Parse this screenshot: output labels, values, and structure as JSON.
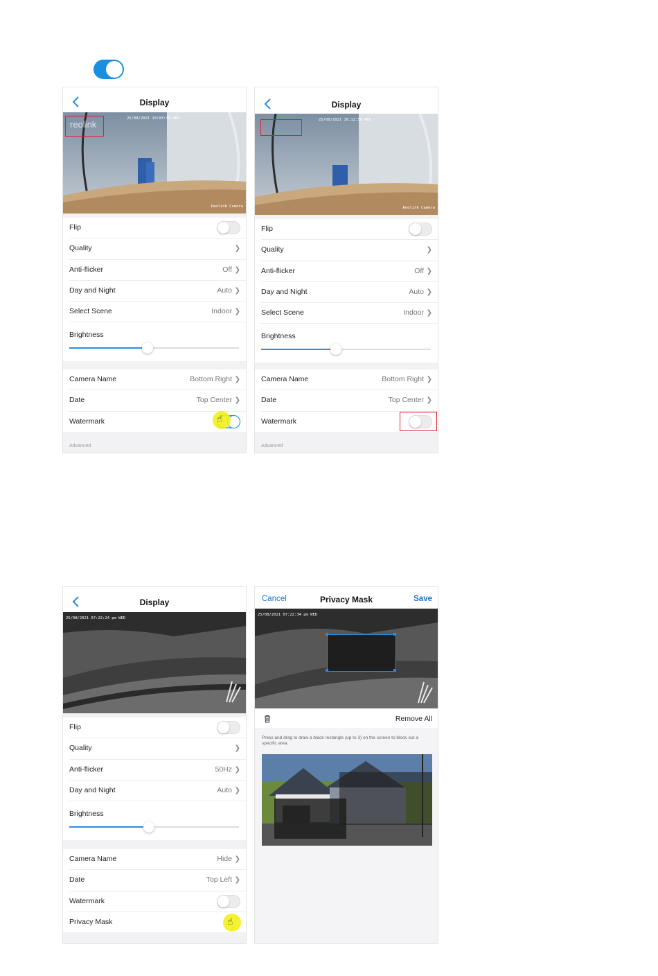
{
  "panel1": {
    "title": "Display",
    "osd_date": "25/08/2021 10:03:35 WED",
    "osd_cam": "Reolink Camera",
    "watermark_logo": "reolink",
    "rows": [
      {
        "label": "Flip"
      },
      {
        "label": "Quality"
      },
      {
        "label": "Anti-flicker",
        "value": "Off"
      },
      {
        "label": "Day and Night",
        "value": "Auto"
      },
      {
        "label": "Select Scene",
        "value": "Indoor"
      }
    ],
    "brightness_label": "Brightness",
    "brightness_level": 0.46,
    "rows2": [
      {
        "label": "Camera Name",
        "value": "Bottom Right"
      },
      {
        "label": "Date",
        "value": "Top Center"
      },
      {
        "label": "Watermark"
      }
    ],
    "advanced": "Advanced"
  },
  "panel2": {
    "title": "Display",
    "osd_date": "25/08/2021 16:12:50 WED",
    "osd_cam": "Reolink Camera",
    "rows": [
      {
        "label": "Flip"
      },
      {
        "label": "Quality"
      },
      {
        "label": "Anti-flicker",
        "value": "Off"
      },
      {
        "label": "Day and Night",
        "value": "Auto"
      },
      {
        "label": "Select Scene",
        "value": "Indoor"
      }
    ],
    "brightness_label": "Brightness",
    "brightness_level": 0.44,
    "rows2": [
      {
        "label": "Camera Name",
        "value": "Bottom Right"
      },
      {
        "label": "Date",
        "value": "Top Center"
      },
      {
        "label": "Watermark"
      }
    ],
    "advanced": "Advanced"
  },
  "panel3": {
    "title": "Display",
    "osd_date": "25/08/2021 07:22:24 pm WED",
    "rows": [
      {
        "label": "Flip"
      },
      {
        "label": "Quality"
      },
      {
        "label": "Anti-flicker",
        "value": "50Hz"
      },
      {
        "label": "Day and Night",
        "value": "Auto"
      }
    ],
    "brightness_label": "Brightness",
    "brightness_level": 0.47,
    "rows2": [
      {
        "label": "Camera Name",
        "value": "Hide"
      },
      {
        "label": "Date",
        "value": "Top Left"
      },
      {
        "label": "Watermark"
      },
      {
        "label": "Privacy Mask"
      }
    ]
  },
  "panel4": {
    "cancel": "Cancel",
    "title": "Privacy Mask",
    "save": "Save",
    "osd_date": "25/08/2021 07:22:34 pm WED",
    "remove_all": "Remove All",
    "help": "Press and drag to draw a black rectangle (up to 3) on the screen to block out a specific area."
  },
  "colors": {
    "accent": "#1a8fe0",
    "highlight": "#e0202a",
    "cursor": "#f3f01c"
  }
}
